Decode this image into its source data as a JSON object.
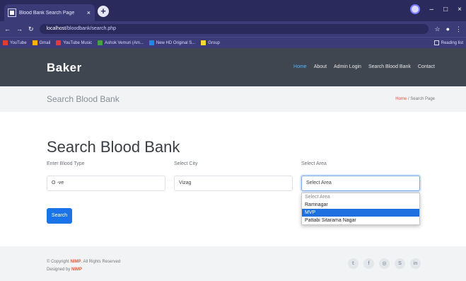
{
  "browser": {
    "tab_title": "Blood Bank Search Page",
    "tab_close": "×",
    "new_tab": "+",
    "url_host": "localhost",
    "url_path": "/bloodbank/search.php",
    "bookmarks": [
      {
        "label": "YouTube",
        "color": "#e53935"
      },
      {
        "label": "Gmail",
        "color": "#ffb300"
      },
      {
        "label": "YouTube Music",
        "color": "#e53935"
      },
      {
        "label": "Ashok Vemuri (Am...",
        "color": "#43a047"
      },
      {
        "label": "New HD Original S...",
        "color": "#1e88e5"
      },
      {
        "label": "Group",
        "color": "#fdd835"
      }
    ],
    "reading_list": "Reading list",
    "controls": [
      "–",
      "□",
      "×"
    ]
  },
  "site": {
    "brand": "Baker",
    "nav": [
      "Home",
      "About",
      "Admin Login",
      "Search Blood Bank",
      "Contact"
    ],
    "active_nav": "Home"
  },
  "breadcrumb": {
    "title": "Search Blood Bank",
    "home": "Home",
    "separator": "/",
    "current": "Search Page"
  },
  "form": {
    "heading": "Search Blood Bank",
    "blood_label": "Enter Blood Type",
    "blood_value": "O -ve",
    "city_label": "Select City",
    "city_value": "Vizag",
    "area_label": "Select Area",
    "area_value": "Select Area",
    "area_options": [
      "Select Area",
      "Ramnagar",
      "MVP",
      "Pattabi Sitarama Nagar"
    ],
    "area_highlighted": "MVP",
    "search_label": "Search"
  },
  "footer": {
    "copyright_prefix": "© Copyright ",
    "copyright_name": "NIMP",
    "copyright_suffix": ". All Rights Reserved",
    "designed_prefix": "Designed by ",
    "designed_name": "NIMP",
    "social": [
      "twitter-icon",
      "facebook-icon",
      "instagram-icon",
      "skype-icon",
      "linkedin-icon"
    ]
  },
  "colors": {
    "browser_dark": "#2a2a5c",
    "navbar": "#404650",
    "accent_blue": "#1b73e8",
    "crumb_red": "#e05a3c"
  }
}
